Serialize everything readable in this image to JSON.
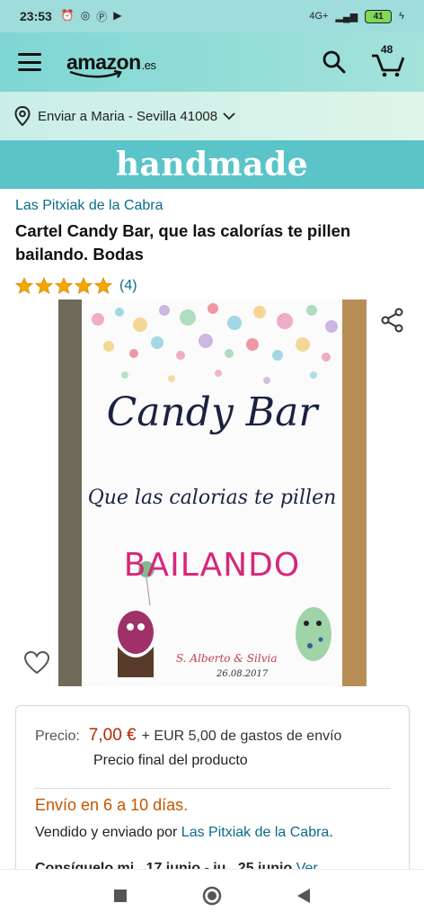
{
  "status_bar": {
    "time": "23:53",
    "signal": "4G+",
    "battery": "41"
  },
  "header": {
    "logo_text": "amazon",
    "logo_suffix": ".es",
    "cart_count": "48"
  },
  "location": {
    "text": "Enviar a Maria - Sevilla 41008"
  },
  "banner": {
    "text": "handmade"
  },
  "product": {
    "brand": "Las Pitxiak de la Cabra",
    "title": "Cartel Candy Bar, que las calorías te pillen bailando. Bodas",
    "rating_stars": 5,
    "rating_count": "(4)",
    "image": {
      "headline": "Candy Bar",
      "subtitle": "Que las calorias te pillen",
      "accent": "BAILANDO",
      "names": "S. Alberto & Silvia",
      "date": "26.08.2017"
    }
  },
  "pricing": {
    "price_label": "Precio:",
    "price": "7,00 €",
    "shipping": "+ EUR 5,00 de gastos de envío",
    "final_label": "Precio final del producto",
    "delivery": "Envío en 6 a 10 días.",
    "sold_by_prefix": "Vendido y enviado por",
    "seller": "Las Pitxiak de la Cabra",
    "sold_by_suffix": ".",
    "get_it": "Consíguelo mi., 17 junio - ju., 25 junio",
    "see_more": "Ver"
  },
  "colors": {
    "header_teal": "#7fd6d4",
    "banner_teal": "#5bc4c9",
    "link": "#0a6c8c",
    "price_red": "#b12704",
    "delivery_orange": "#c45500",
    "star": "#f7a600"
  }
}
